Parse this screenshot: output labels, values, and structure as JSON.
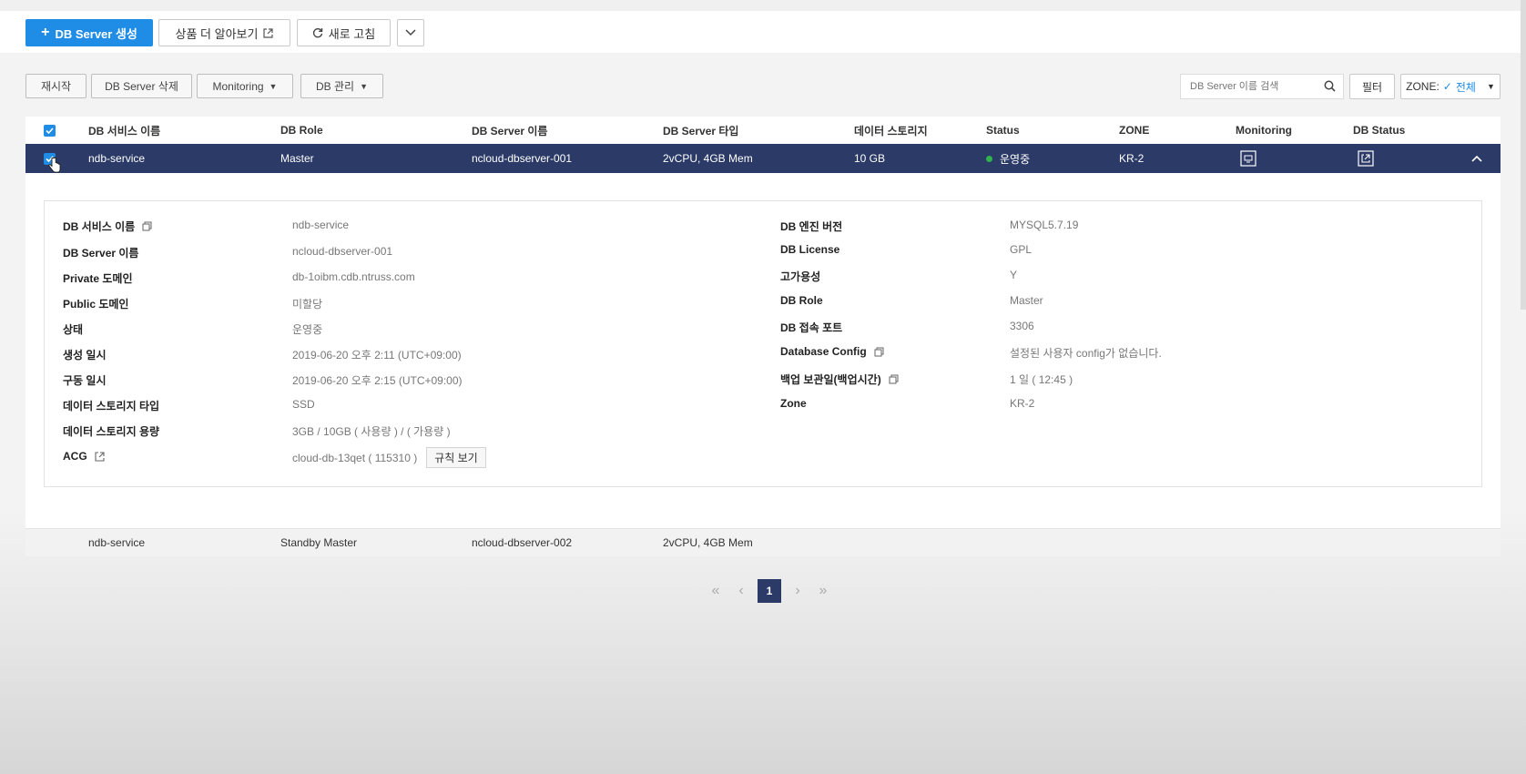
{
  "toolbar": {
    "create_label": "DB Server 생성",
    "learn_more_label": "상품 더 알아보기",
    "refresh_label": "새로 고침"
  },
  "actions": {
    "restart_label": "재시작",
    "delete_label": "DB Server 삭제",
    "monitoring_label": "Monitoring",
    "db_manage_label": "DB 관리",
    "search_placeholder": "DB Server 이름 검색",
    "filter_label": "필터",
    "zone_prefix": "ZONE:",
    "zone_value": "전체"
  },
  "table": {
    "headers": [
      "DB 서비스 이름",
      "DB Role",
      "DB Server 이름",
      "DB Server 타입",
      "데이터 스토리지",
      "Status",
      "ZONE",
      "Monitoring",
      "DB Status"
    ],
    "rows": [
      {
        "service": "ndb-service",
        "role": "Master",
        "server": "ncloud-dbserver-001",
        "type": "2vCPU, 4GB Mem",
        "storage": "10 GB",
        "status": "운영중",
        "zone": "KR-2"
      },
      {
        "service": "ndb-service",
        "role": "Standby Master",
        "server": "ncloud-dbserver-002",
        "type": "2vCPU, 4GB Mem"
      }
    ]
  },
  "detail": {
    "left": [
      {
        "label": "DB 서비스 이름",
        "value": "ndb-service"
      },
      {
        "label": "DB Server 이름",
        "value": "ncloud-dbserver-001"
      },
      {
        "label": "Private 도메인",
        "value": "db-1oibm.cdb.ntruss.com"
      },
      {
        "label": "Public 도메인",
        "value": "미할당"
      },
      {
        "label": "상태",
        "value": "운영중"
      },
      {
        "label": "생성 일시",
        "value": "2019-06-20 오후 2:11 (UTC+09:00)"
      },
      {
        "label": "구동 일시",
        "value": "2019-06-20 오후 2:15 (UTC+09:00)"
      },
      {
        "label": "데이터 스토리지 타입",
        "value": "SSD"
      },
      {
        "label": "데이터 스토리지 용량",
        "value": "3GB / 10GB ( 사용량 ) / ( 가용량 )"
      },
      {
        "label": "ACG",
        "value": "cloud-db-13qet ( 115310 )"
      }
    ],
    "acg_rule_button": "규칙 보기",
    "right": [
      {
        "label": "DB 엔진 버전",
        "value": "MYSQL5.7.19"
      },
      {
        "label": "DB License",
        "value": "GPL"
      },
      {
        "label": "고가용성",
        "value": "Y"
      },
      {
        "label": "DB Role",
        "value": "Master"
      },
      {
        "label": "DB 접속 포트",
        "value": "3306"
      },
      {
        "label": "Database Config",
        "value": "설정된 사용자 config가 없습니다."
      },
      {
        "label": "백업 보관일(백업시간)",
        "value": "1 일 ( 12:45 )"
      },
      {
        "label": "Zone",
        "value": "KR-2"
      }
    ]
  },
  "pagination": {
    "current": "1"
  },
  "colors": {
    "primary": "#1f8ce6",
    "selected_row": "#2b3a67",
    "status_running": "#2fb34a"
  }
}
